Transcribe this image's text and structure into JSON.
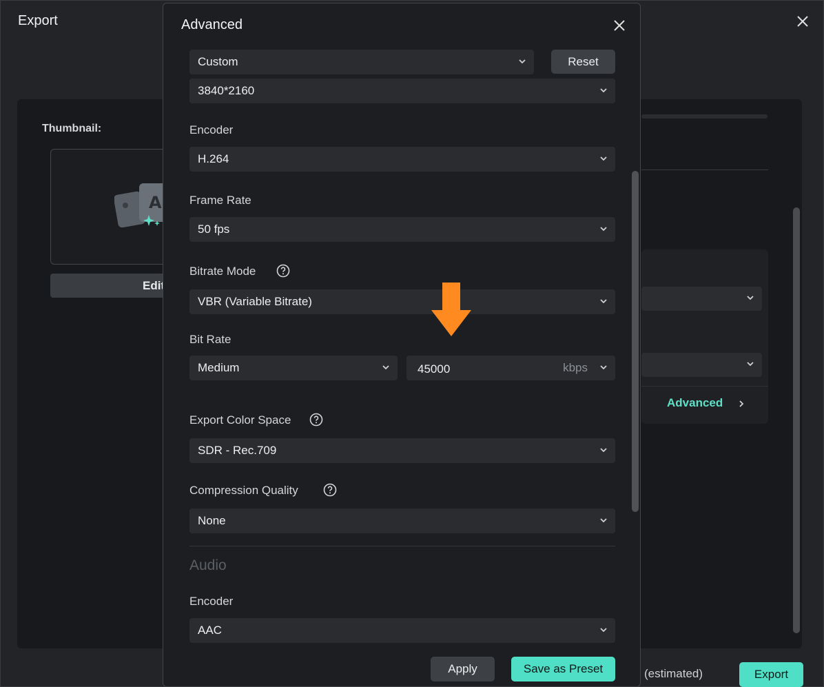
{
  "export_window": {
    "title": "Export",
    "thumbnail_label": "Thumbnail:",
    "edit_button": "Edit",
    "advanced_link": "Advanced",
    "estimated_text": "(estimated)",
    "export_button": "Export"
  },
  "dialog": {
    "title": "Advanced",
    "preset": {
      "value": "Custom"
    },
    "reset_button": "Reset",
    "resolution": {
      "value": "3840*2160"
    },
    "encoder": {
      "label": "Encoder",
      "value": "H.264"
    },
    "frame_rate": {
      "label": "Frame Rate",
      "value": "50 fps"
    },
    "bitrate_mode": {
      "label": "Bitrate Mode",
      "value": "VBR (Variable Bitrate)"
    },
    "bit_rate": {
      "label": "Bit Rate",
      "level": "Medium",
      "value": "45000",
      "unit": "kbps"
    },
    "color_space": {
      "label": "Export Color Space",
      "value": "SDR - Rec.709"
    },
    "compression": {
      "label": "Compression Quality",
      "value": "None"
    },
    "audio_section": "Audio",
    "audio_encoder": {
      "label": "Encoder",
      "value": "AAC"
    },
    "apply_button": "Apply",
    "save_preset_button": "Save as Preset"
  },
  "colors": {
    "accent": "#4fdec6",
    "annotation_arrow": "#ff8a1f"
  }
}
